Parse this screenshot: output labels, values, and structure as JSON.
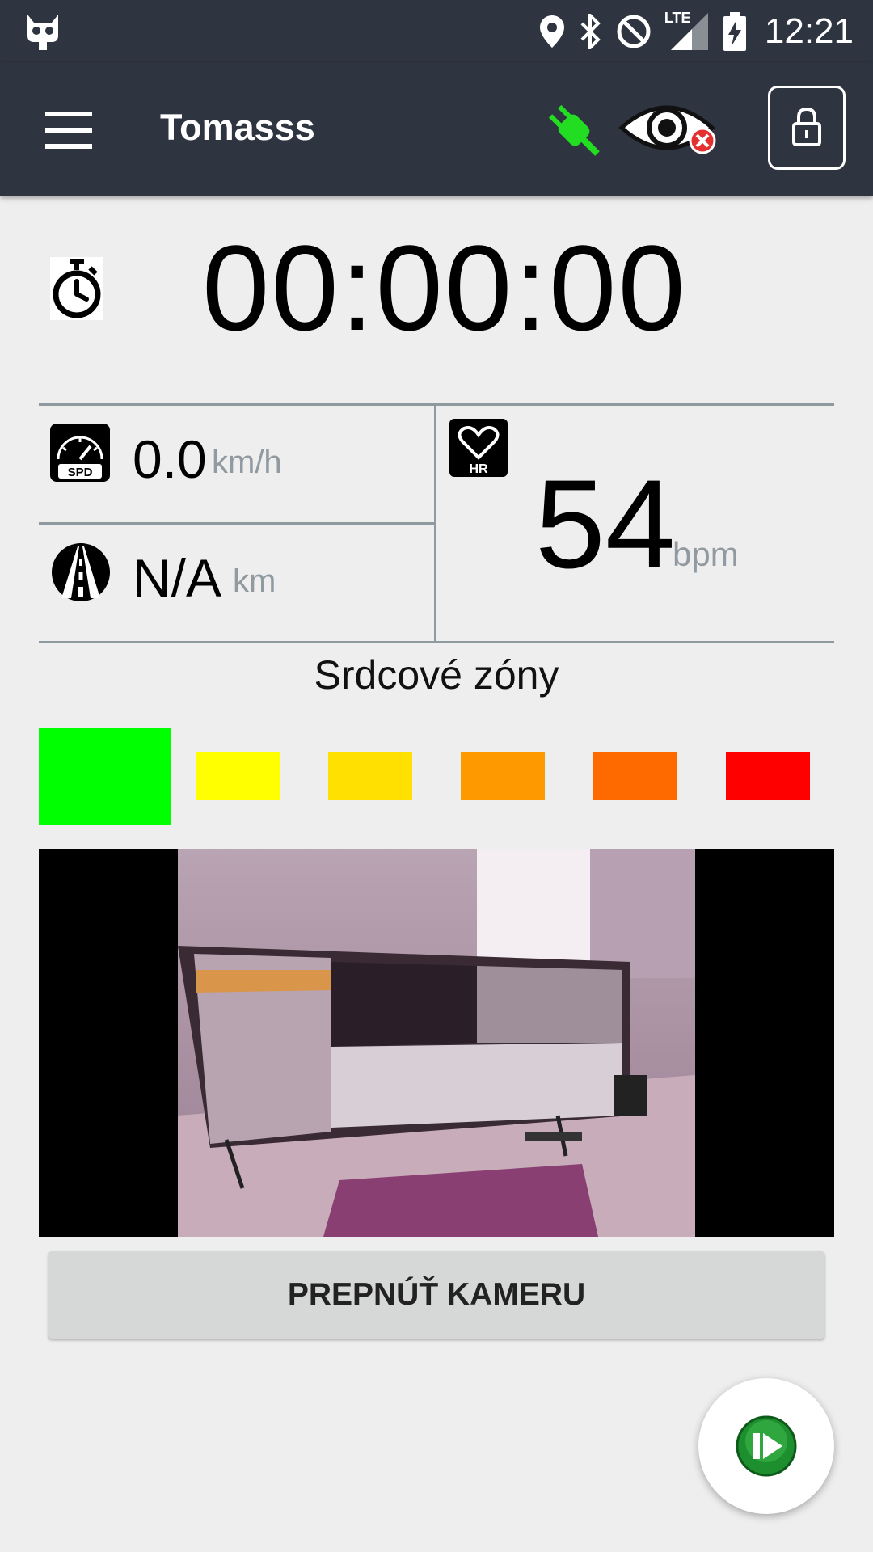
{
  "status_bar": {
    "time": "12:21",
    "network_label": "LTE",
    "icons": [
      "cyanogen-bot-icon",
      "location-icon",
      "bluetooth-icon",
      "do-not-disturb-icon",
      "signal-icon",
      "battery-charging-icon"
    ]
  },
  "app_bar": {
    "title": "Tomasss",
    "icons": [
      "menu-icon",
      "plug-connected-icon",
      "eye-disabled-icon",
      "lock-icon"
    ],
    "connection_color": "#22dd22"
  },
  "timer": {
    "icon": "stopwatch-icon",
    "value": "00:00:00"
  },
  "speed": {
    "icon": "speedometer-icon",
    "icon_label": "SPD",
    "value": "0.0",
    "unit": "km/h"
  },
  "distance": {
    "icon": "road-icon",
    "value": "N/A",
    "unit": "km"
  },
  "heart_rate": {
    "icon": "heart-icon",
    "icon_label": "HR",
    "value": "54",
    "unit": "bpm"
  },
  "zones": {
    "title": "Srdcové zóny",
    "active_index": 0,
    "items": [
      {
        "color": "#00ff00"
      },
      {
        "color": "#ffff00"
      },
      {
        "color": "#ffe000"
      },
      {
        "color": "#ff9900"
      },
      {
        "color": "#ff6a00"
      },
      {
        "color": "#ff0000"
      }
    ]
  },
  "camera": {
    "switch_label": "PREPNÚŤ KAMERU"
  },
  "fab": {
    "icon": "play-pause-icon",
    "color": "#1e8f2e"
  }
}
